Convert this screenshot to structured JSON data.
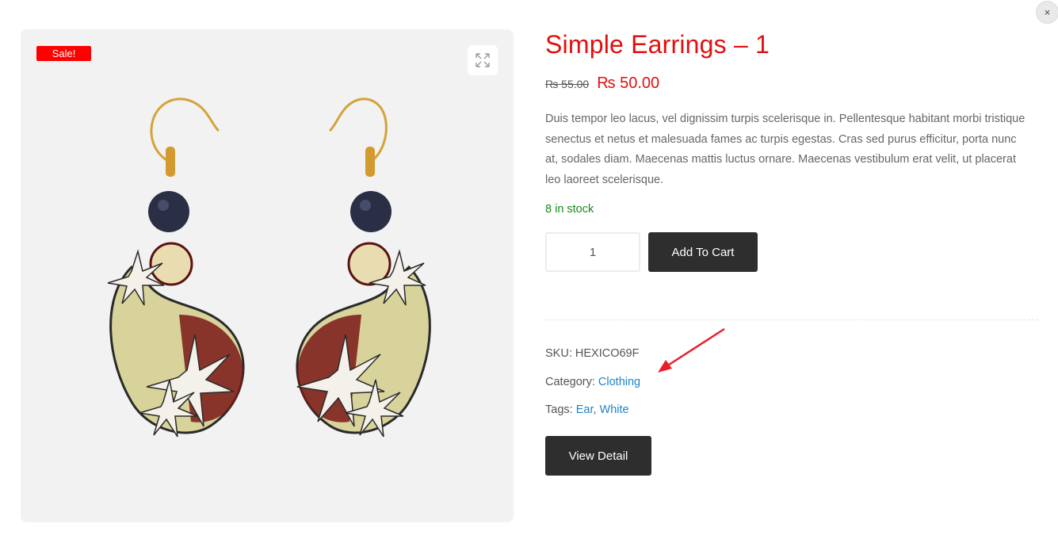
{
  "close_symbol": "×",
  "gallery": {
    "sale_badge": "Sale!",
    "zoom_icon": "expand-arrows-icon",
    "image_alt": "Simple Earrings – 1"
  },
  "product": {
    "title": "Simple Earrings – 1",
    "price_old": "₨ 55.00",
    "price_new": "₨ 50.00",
    "description": "Duis tempor leo lacus, vel dignissim turpis scelerisque in. Pellentesque habitant morbi tristique senectus et netus et malesuada fames ac turpis egestas. Cras sed purus efficitur, porta nunc at, sodales diam. Maecenas mattis luctus ornare. Maecenas vestibulum erat velit, ut placerat leo laoreet scelerisque.",
    "stock": "8 in stock",
    "quantity": "1",
    "add_to_cart": "Add To Cart",
    "sku_label": "SKU:",
    "sku_value": "HEXICO69F",
    "category_label": "Category:",
    "category_value": "Clothing",
    "tags_label": "Tags:",
    "tags": [
      "Ear",
      "White"
    ],
    "tag_separator": ",",
    "view_detail": "View Detail"
  },
  "colors": {
    "accent_red": "#e01010",
    "sale_red": "#ff0000",
    "stock_green": "#1a8a1a",
    "link_blue": "#1f84c8",
    "button_dark": "#2e2e2e",
    "annotation_arrow": "#e8202a"
  }
}
